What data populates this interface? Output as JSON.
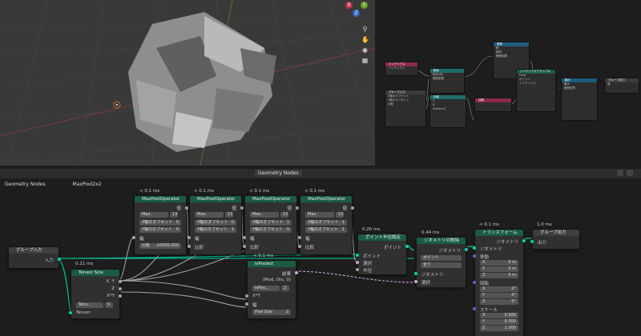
{
  "viewport": {
    "gizmo_x": "X",
    "gizmo_y": "Y",
    "gizmo_z": "Z",
    "tools": [
      "zoom-icon",
      "hand-icon",
      "camera-icon",
      "grid-icon"
    ]
  },
  "mini_editor": {
    "nodes": [
      {
        "title": "インデックス",
        "rows": [
          "インデックス"
        ]
      },
      {
        "title": "グループ入力",
        "rows": [
          "X軸のオフセット",
          "Y軸のオフセット",
          "比較"
        ]
      },
      {
        "title": "剰余",
        "rows": [
          "剰余(床)",
          "範囲制限"
        ]
      },
      {
        "title": "比較",
        "rows": [
          "整数",
          "等しい",
          "A",
          "B",
          "Add(end)"
        ]
      },
      {
        "title": "乗算",
        "rows": [
          "積",
          "乗算",
          "範囲制限"
        ]
      },
      {
        "title": "加算",
        "rows": []
      },
      {
        "title": "インデックスでサンプル",
        "rows": [
          "Float",
          "ポイント",
          "インデックス"
        ]
      },
      {
        "title": "最大",
        "rows": [
          "最大",
          "範囲制限"
        ]
      },
      {
        "title": "グループ出力",
        "rows": [
          "値"
        ]
      }
    ]
  },
  "editor": {
    "header_title": "Geometry Nodes",
    "breadcrumb": [
      "Geometry Nodes",
      "MaxPool2x2"
    ],
    "maxpool_nodes": [
      {
        "time": "< 0.1 ms",
        "title": "MaxPoolOperator",
        "value_label": "値",
        "field_label": "Max.",
        "field_num": "13",
        "x_label": "X軸のオフセット",
        "x_val": "0",
        "y_label": "Y軸のオフセット",
        "y_val": "0",
        "width_label": "幅",
        "compare_label": "比較",
        "compare_val": "-10000.000"
      },
      {
        "time": "< 0.1 ms",
        "title": "MaxPoolOperator",
        "value_label": "値",
        "field_label": "Max.",
        "field_num": "13",
        "x_label": "X軸のオフセット",
        "x_val": "0",
        "y_label": "Y軸のオフセット",
        "y_val": "1",
        "width_label": "幅",
        "compare_label": "比較",
        "compare_val": ""
      },
      {
        "time": "< 0.1 ms",
        "title": "MaxPoolOperator",
        "value_label": "値",
        "field_label": "Max.",
        "field_num": "13",
        "x_label": "X軸のオフセット",
        "x_val": "1",
        "y_label": "Y軸のオフセット",
        "y_val": "0",
        "width_label": "幅",
        "compare_label": "比較",
        "compare_val": ""
      },
      {
        "time": "< 0.1 ms",
        "title": "MaxPoolOperator",
        "value_label": "値",
        "field_label": "Max.",
        "field_num": "13",
        "x_label": "X軸のオフセット",
        "x_val": "1",
        "y_label": "Y軸のオフセット",
        "y_val": "1",
        "width_label": "幅",
        "compare_label": "比較",
        "compare_val": ""
      }
    ],
    "group_input": {
      "title": "グループ入力",
      "socket": "入力"
    },
    "tensor_size": {
      "time": "0.11 ms",
      "title": "Tensor Size",
      "outputs": [
        "X, Y",
        "Z",
        "X*Y"
      ],
      "field": "Tens...",
      "num": "5",
      "input": "Tensor"
    },
    "is_pooled": {
      "time": "< 0.1 ms",
      "title": "IsPooled",
      "outputs": [
        "結果",
        "(Mod, Div, 0)"
      ],
      "field": "IsPoo...",
      "num": "2",
      "inputs": [
        "X*Y",
        "幅",
        "Pool Size"
      ],
      "pool_size": "2"
    },
    "set_position": {
      "time": "0.26 ms",
      "title": "ポイント半径設定",
      "outputs": [
        "ポイント"
      ],
      "inputs": [
        "ポイント",
        "選択",
        "半径"
      ]
    },
    "delete_geo": {
      "time": "0.44 ms",
      "title": "ジオメトリの削除",
      "outputs": [
        "ジオメトリ"
      ],
      "domain": "ポイント",
      "mode": "全て",
      "inputs": [
        "ジオメトリ",
        "選択"
      ]
    },
    "transform": {
      "time": "< 0.1 ms",
      "title": "トランスフォーム",
      "output": "ジオメトリ",
      "input": "ジオメトリ",
      "translation_label": "移動",
      "translation": [
        "0 m",
        "0 m",
        "0 m"
      ],
      "rotation_label": "回転",
      "rotation": [
        "0°",
        "0°",
        "0°"
      ],
      "scale_label": "スケール",
      "scale": [
        "0.500",
        "0.500",
        "1.000"
      ],
      "axes": [
        "X",
        "Y",
        "Z"
      ]
    },
    "group_output": {
      "time": "1.0 ms",
      "title": "グループ出力",
      "input": "出力"
    }
  }
}
